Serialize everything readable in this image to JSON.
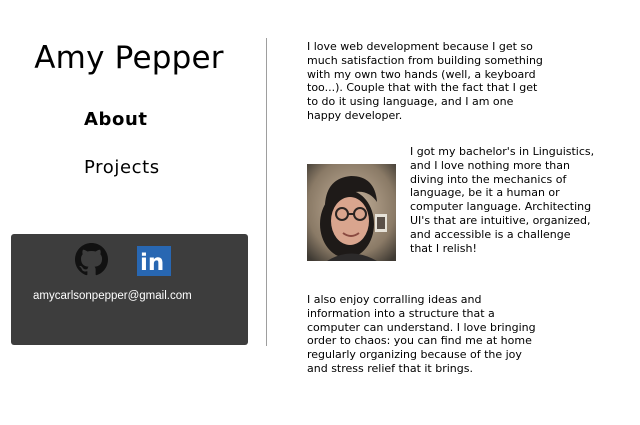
{
  "sidebar": {
    "name": "Amy Pepper",
    "nav": {
      "about": "About",
      "projects": "Projects"
    },
    "contact": {
      "github_icon": "github-icon",
      "linkedin_icon": "linkedin-icon",
      "linkedin_letters": "in",
      "email": "amycarlsonpepper@gmail.com"
    }
  },
  "main": {
    "paragraphs": [
      "I love web development because I get so much satisfaction from building something with my own two hands (well, a keyboard too...). Couple that with the fact that I get to do it using language, and I am one happy developer.",
      "I got my bachelor's in Linguistics, and I love nothing more than diving into the mechanics of language, be it a human or computer language. Architecting UI's that are intuitive, organized, and accessible is a challenge that I relish!",
      "I also enjoy corralling ideas and information into a structure that a computer can understand. I love bringing order to chaos: you can find me at home regularly organizing because of the joy and stress relief that it brings."
    ],
    "portrait_icon": "profile-photo"
  },
  "colors": {
    "contact_card_bg": "#3d3d3d",
    "linkedin_blue": "#2867b2",
    "github_black": "#111111",
    "divider": "#9e9e9e"
  }
}
